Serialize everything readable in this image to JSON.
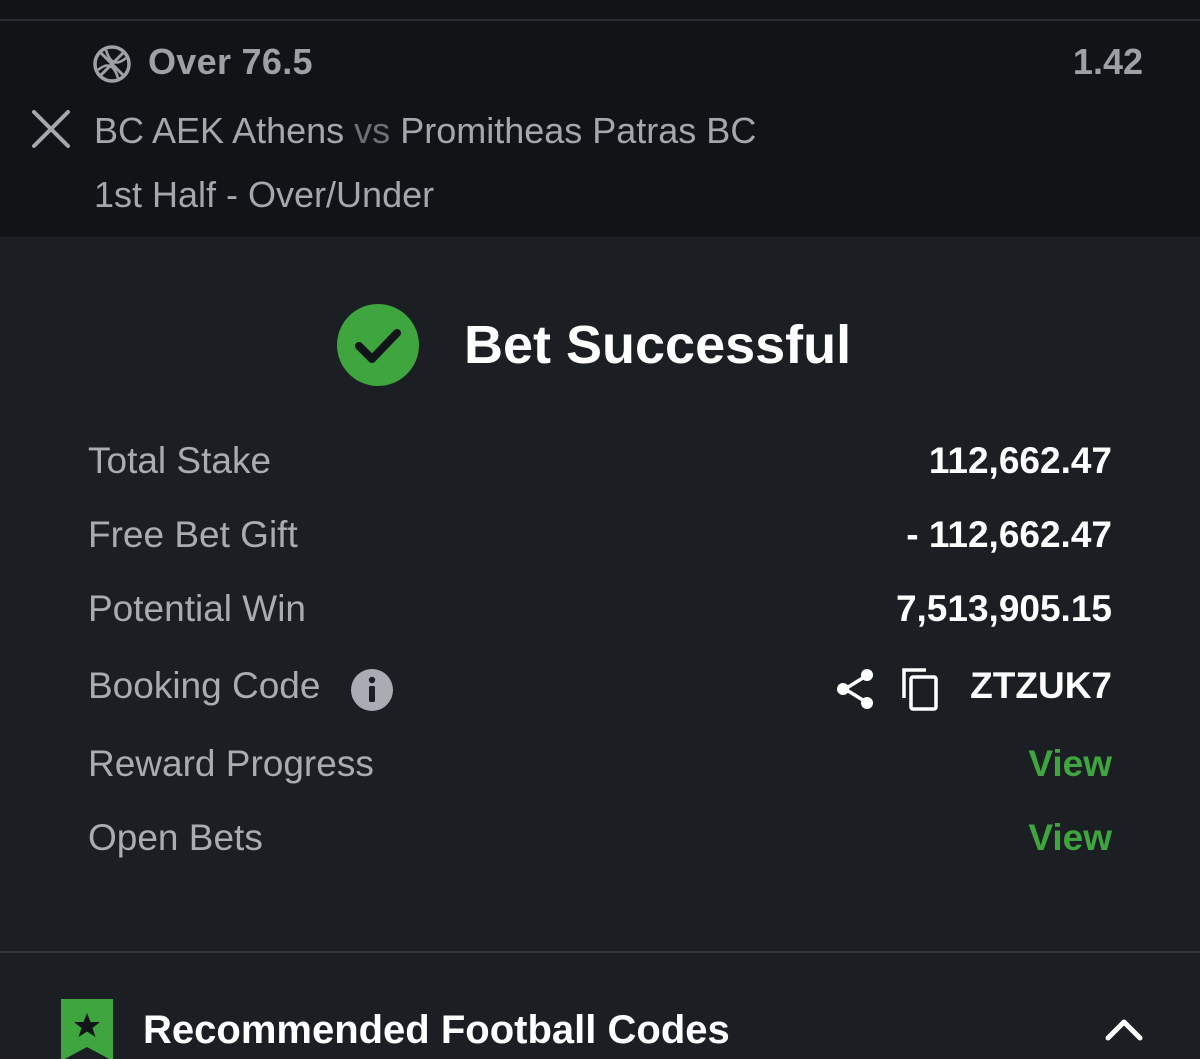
{
  "selection": {
    "pick": "Over 76.5",
    "odds": "1.42",
    "home_team": "BC AEK Athens",
    "vs": "vs",
    "away_team": "Promitheas Patras BC",
    "market": "1st Half - Over/Under",
    "sport_icon": "basketball-icon",
    "remove_icon": "close-icon"
  },
  "result": {
    "title": "Bet Successful",
    "status_icon": "check-circle-icon",
    "status_color": "#3fa53f"
  },
  "summary": {
    "total_stake": {
      "label": "Total Stake",
      "value": "112,662.47"
    },
    "free_bet_gift": {
      "label": "Free Bet Gift",
      "value": "- 112,662.47"
    },
    "potential_win": {
      "label": "Potential Win",
      "value": "7,513,905.15"
    },
    "booking_code": {
      "label": "Booking Code",
      "value": "ZTZUK7",
      "icons": [
        "info-icon",
        "share-icon",
        "copy-icon"
      ]
    },
    "reward_progress": {
      "label": "Reward Progress",
      "link": "View"
    },
    "open_bets": {
      "label": "Open Bets",
      "link": "View"
    }
  },
  "recommended": {
    "title": "Recommended Football Codes",
    "badge_icon": "star-bookmark-icon",
    "toggle_icon": "chevron-up-icon"
  },
  "colors": {
    "background": "#1b1e23",
    "card_background": "#121317",
    "accent_green": "#3fa53f"
  }
}
